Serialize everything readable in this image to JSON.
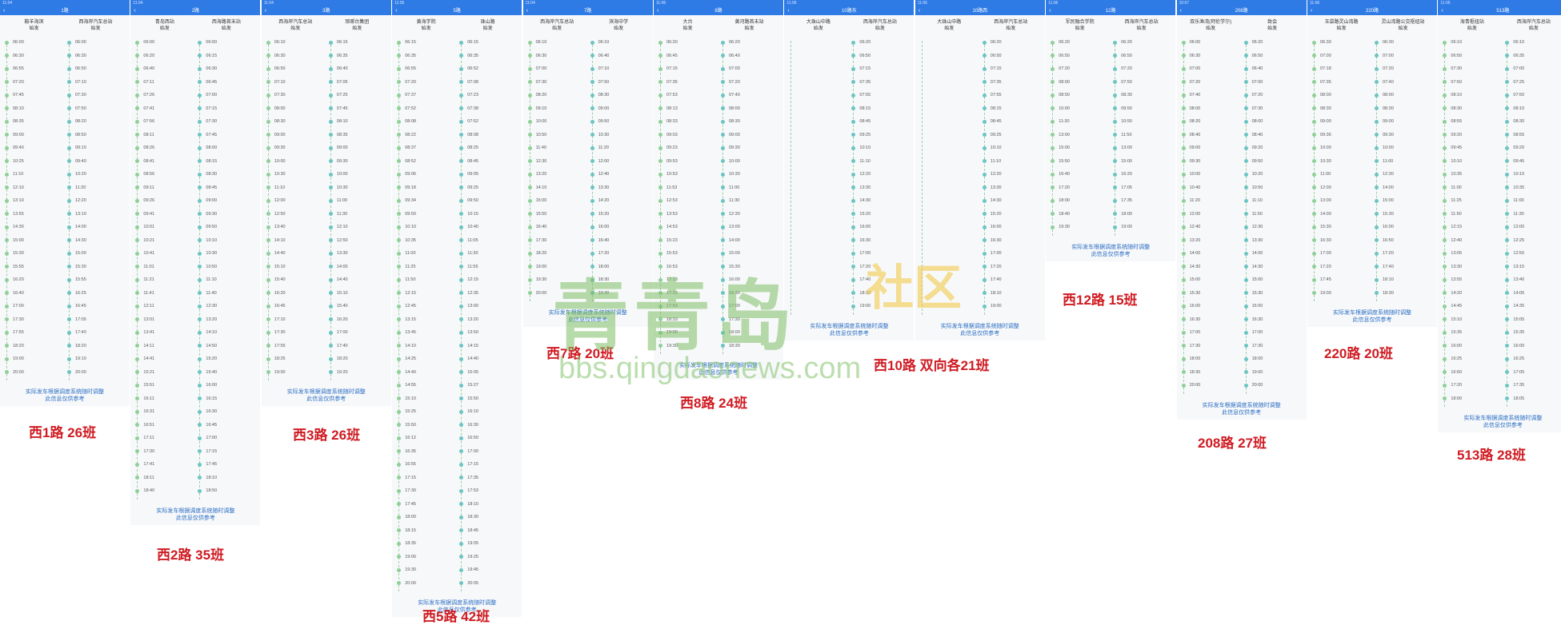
{
  "note_line1": "实际发车根据调度系统随时调整",
  "note_line2": "此信息仅供参考",
  "watermark": {
    "brand": "青青岛",
    "sub": "社区",
    "url": "bbs.qingdaonews.com"
  },
  "panels": [
    {
      "time": "11:04",
      "route": "1路",
      "head_left": "鞍羊海滨\n始发",
      "head_right": "西海岸汽车总站\n始发",
      "times_left": [
        "06:00",
        "06:30",
        "06:55",
        "07:20",
        "07:45",
        "08:10",
        "08:35",
        "09:00",
        "09:40",
        "10:25",
        "11:10",
        "12:10",
        "13:10",
        "13:55",
        "14:30",
        "15:00",
        "15:30",
        "15:55",
        "16:20",
        "16:40",
        "17:00",
        "17:30",
        "17:55",
        "18:20",
        "19:00",
        "20:00"
      ],
      "times_right": [
        "06:00",
        "06:30",
        "06:50",
        "07:10",
        "07:30",
        "07:50",
        "08:20",
        "08:50",
        "09:10",
        "09:40",
        "10:20",
        "11:20",
        "12:20",
        "13:10",
        "14:00",
        "14:30",
        "15:00",
        "15:30",
        "15:55",
        "16:25",
        "16:45",
        "17:05",
        "17:40",
        "18:20",
        "19:10",
        "20:00"
      ],
      "caption": "西1路 26班"
    },
    {
      "time": "11:04",
      "route": "2路",
      "head_left": "青岛西站\n始发",
      "head_right": "西海路首末站\n始发",
      "times_left": [
        "06:00",
        "06:20",
        "06:40",
        "07:11",
        "07:26",
        "07:41",
        "07:56",
        "08:11",
        "08:26",
        "08:41",
        "08:56",
        "09:11",
        "09:26",
        "09:41",
        "10:01",
        "10:21",
        "10:41",
        "11:01",
        "11:21",
        "11:41",
        "12:11",
        "13:01",
        "13:41",
        "14:11",
        "14:41",
        "15:21",
        "15:51",
        "16:11",
        "16:31",
        "16:51",
        "17:11",
        "17:30",
        "17:41",
        "18:11",
        "18:40"
      ],
      "times_right": [
        "06:00",
        "06:15",
        "06:30",
        "06:45",
        "07:00",
        "07:15",
        "07:30",
        "07:45",
        "08:00",
        "08:15",
        "08:30",
        "08:45",
        "09:00",
        "09:30",
        "09:50",
        "10:10",
        "10:30",
        "10:50",
        "11:10",
        "11:40",
        "12:30",
        "13:20",
        "14:10",
        "14:50",
        "15:20",
        "15:40",
        "16:00",
        "16:15",
        "16:30",
        "16:45",
        "17:00",
        "17:15",
        "17:45",
        "18:10",
        "18:50"
      ],
      "caption": "西2路 35班"
    },
    {
      "time": "11:04",
      "route": "3路",
      "head_left": "西海岸汽车总站\n始发",
      "head_right": "琅琊台集团\n始发",
      "times_left": [
        "06:10",
        "06:30",
        "06:50",
        "07:10",
        "07:30",
        "08:00",
        "08:30",
        "09:00",
        "09:30",
        "10:00",
        "10:30",
        "11:10",
        "12:00",
        "12:50",
        "13:40",
        "14:10",
        "14:40",
        "15:10",
        "15:40",
        "16:20",
        "16:45",
        "17:10",
        "17:30",
        "17:55",
        "18:25",
        "19:00"
      ],
      "times_right": [
        "06:15",
        "06:35",
        "06:40",
        "07:05",
        "07:25",
        "07:45",
        "08:10",
        "08:35",
        "09:00",
        "09:30",
        "10:00",
        "10:30",
        "11:00",
        "11:30",
        "12:10",
        "12:50",
        "13:30",
        "14:00",
        "14:40",
        "15:10",
        "15:40",
        "16:20",
        "17:00",
        "17:40",
        "18:20",
        "19:20"
      ],
      "caption": "西3路 26班"
    },
    {
      "time": "11:05",
      "route": "5路",
      "head_left": "黄海学院\n始发",
      "head_right": "珠山路\n始发",
      "times_left": [
        "06:15",
        "06:35",
        "06:55",
        "07:20",
        "07:37",
        "07:52",
        "08:08",
        "08:22",
        "08:37",
        "08:52",
        "09:06",
        "09:18",
        "09:34",
        "09:50",
        "10:10",
        "10:35",
        "11:00",
        "11:25",
        "11:50",
        "12:15",
        "12:45",
        "13:15",
        "13:45",
        "14:10",
        "14:25",
        "14:40",
        "14:55",
        "15:10",
        "15:25",
        "15:50",
        "16:12",
        "16:35",
        "16:55",
        "17:15",
        "17:30",
        "17:45",
        "18:00",
        "18:15",
        "18:35",
        "19:00",
        "19:30",
        "20:00"
      ],
      "times_right": [
        "06:15",
        "06:35",
        "06:52",
        "07:08",
        "07:23",
        "07:38",
        "07:52",
        "08:08",
        "08:25",
        "08:45",
        "09:05",
        "09:25",
        "09:50",
        "10:15",
        "10:40",
        "11:05",
        "11:30",
        "11:55",
        "12:15",
        "12:35",
        "13:00",
        "13:20",
        "13:50",
        "14:15",
        "14:40",
        "15:05",
        "15:27",
        "15:50",
        "16:10",
        "16:30",
        "16:50",
        "17:00",
        "17:15",
        "17:35",
        "17:53",
        "18:10",
        "18:30",
        "18:45",
        "19:05",
        "19:25",
        "19:45",
        "20:05"
      ],
      "caption": "西5路 42班"
    },
    {
      "time": "11:04",
      "route": "7路",
      "head_left": "西海岸汽车总站\n始发",
      "head_right": "滨海中学\n始发",
      "times_left": [
        "06:10",
        "06:30",
        "07:00",
        "07:30",
        "08:20",
        "09:10",
        "10:00",
        "10:50",
        "11:40",
        "12:30",
        "13:20",
        "14:10",
        "15:00",
        "15:50",
        "16:40",
        "17:30",
        "18:20",
        "19:00",
        "19:30",
        "20:00"
      ],
      "times_right": [
        "06:10",
        "06:40",
        "07:10",
        "07:50",
        "08:30",
        "09:00",
        "09:50",
        "10:30",
        "11:20",
        "12:00",
        "12:40",
        "13:30",
        "14:20",
        "15:20",
        "16:00",
        "16:40",
        "17:20",
        "18:00",
        "18:30",
        "19:30"
      ],
      "caption": "西7路 20班"
    },
    {
      "time": "11:06",
      "route": "8路",
      "head_left": "大台\n始发",
      "head_right": "黄河路首末站\n始发",
      "times_left": [
        "06:20",
        "06:45",
        "07:15",
        "07:35",
        "07:53",
        "08:13",
        "08:33",
        "09:03",
        "09:23",
        "09:53",
        "10:53",
        "11:53",
        "12:53",
        "13:53",
        "14:53",
        "15:23",
        "15:53",
        "16:53",
        "17:13",
        "17:33",
        "17:53",
        "18:33",
        "19:00",
        "19:30"
      ],
      "times_right": [
        "06:20",
        "06:40",
        "07:00",
        "07:20",
        "07:40",
        "08:00",
        "08:30",
        "09:00",
        "09:30",
        "10:00",
        "10:30",
        "11:00",
        "11:30",
        "12:30",
        "13:00",
        "14:00",
        "15:00",
        "15:30",
        "16:00",
        "16:30",
        "17:00",
        "17:30",
        "18:00",
        "18:30"
      ],
      "caption": "西8路 24班"
    },
    {
      "time": "11:06",
      "route": "10路东",
      "head_left": "大珠山中路\n始发",
      "head_right": "西海岸汽车总站\n始发",
      "times_left": [],
      "times_right": [
        "06:20",
        "06:50",
        "07:15",
        "07:35",
        "07:55",
        "08:15",
        "08:45",
        "09:25",
        "10:10",
        "11:10",
        "12:20",
        "13:30",
        "14:30",
        "15:20",
        "16:00",
        "16:30",
        "17:00",
        "17:20",
        "17:40",
        "18:10",
        "19:00"
      ],
      "caption": ""
    },
    {
      "time": "11:06",
      "route": "10路西",
      "head_left": "大珠山中路\n始发",
      "head_right": "西海岸汽车总站\n始发",
      "times_left": [],
      "times_right": [
        "06:20",
        "06:50",
        "07:15",
        "07:35",
        "07:55",
        "08:15",
        "08:45",
        "09:25",
        "10:10",
        "11:10",
        "12:20",
        "13:30",
        "14:30",
        "15:20",
        "16:00",
        "16:30",
        "17:00",
        "17:20",
        "17:40",
        "18:10",
        "19:00"
      ],
      "caption": "西10路 双向各21班"
    },
    {
      "time": "11:06",
      "route": "12路",
      "head_left": "军民融合学院\n始发",
      "head_right": "西海岸汽车总站\n始发",
      "times_left": [
        "06:20",
        "06:50",
        "07:20",
        "08:00",
        "08:50",
        "10:00",
        "11:30",
        "13:00",
        "15:00",
        "15:50",
        "16:40",
        "17:20",
        "18:00",
        "18:40",
        "19:30"
      ],
      "times_right": [
        "06:20",
        "06:50",
        "07:20",
        "07:50",
        "08:30",
        "09:50",
        "10:50",
        "11:50",
        "13:00",
        "15:00",
        "16:20",
        "17:05",
        "17:35",
        "18:00",
        "19:00"
      ],
      "caption": "西12路 15班"
    },
    {
      "time": "10:07",
      "route": "208路",
      "head_left": "双乐渔湾(珂伦学尔)\n始发",
      "head_right": "致会\n始发",
      "times_left": [
        "06:00",
        "06:30",
        "07:00",
        "07:20",
        "07:40",
        "08:00",
        "08:20",
        "08:40",
        "09:00",
        "09:30",
        "10:00",
        "10:40",
        "11:20",
        "12:00",
        "12:40",
        "13:20",
        "14:00",
        "14:30",
        "15:00",
        "15:30",
        "16:00",
        "16:30",
        "17:00",
        "17:30",
        "18:00",
        "18:30",
        "20:00"
      ],
      "times_right": [
        "06:20",
        "06:50",
        "06:40",
        "07:00",
        "07:20",
        "07:30",
        "08:00",
        "08:40",
        "09:20",
        "09:50",
        "10:20",
        "10:50",
        "11:10",
        "11:50",
        "12:30",
        "13:30",
        "14:00",
        "14:30",
        "15:00",
        "15:30",
        "16:00",
        "16:30",
        "17:00",
        "17:30",
        "18:00",
        "19:00",
        "20:00"
      ],
      "caption": "208路 27班"
    },
    {
      "time": "11:06",
      "route": "220路",
      "head_left": "玉袋路灵山湾路\n始发",
      "head_right": "灵山湾路公交枢纽站\n始发",
      "times_left": [
        "06:30",
        "07:00",
        "07:18",
        "07:35",
        "08:00",
        "08:30",
        "09:00",
        "09:36",
        "10:00",
        "10:30",
        "11:00",
        "12:00",
        "13:00",
        "14:00",
        "15:30",
        "16:30",
        "17:00",
        "17:20",
        "17:45",
        "19:00"
      ],
      "times_right": [
        "06:30",
        "07:00",
        "07:20",
        "07:40",
        "08:00",
        "08:30",
        "09:00",
        "09:30",
        "10:00",
        "11:00",
        "12:30",
        "14:00",
        "15:00",
        "15:30",
        "16:00",
        "16:50",
        "17:20",
        "17:40",
        "18:10",
        "18:30"
      ],
      "caption": "220路 20班"
    },
    {
      "time": "11:05",
      "route": "513路",
      "head_left": "海青枢纽站\n始发",
      "head_right": "西海岸汽车总站\n始发",
      "times_left": [
        "06:10",
        "06:50",
        "07:30",
        "07:50",
        "08:10",
        "08:30",
        "08:55",
        "09:20",
        "09:45",
        "10:10",
        "10:35",
        "11:00",
        "11:25",
        "11:50",
        "12:15",
        "12:40",
        "13:05",
        "13:30",
        "13:55",
        "14:20",
        "14:45",
        "15:10",
        "15:35",
        "16:00",
        "16:25",
        "16:50",
        "17:20",
        "18:00"
      ],
      "times_right": [
        "06:10",
        "06:35",
        "07:00",
        "07:25",
        "07:50",
        "08:10",
        "08:30",
        "08:55",
        "09:20",
        "09:45",
        "10:10",
        "10:35",
        "11:00",
        "11:30",
        "12:00",
        "12:25",
        "12:50",
        "13:15",
        "13:40",
        "14:05",
        "14:35",
        "15:05",
        "15:35",
        "16:00",
        "16:25",
        "17:05",
        "17:35",
        "18:05"
      ],
      "caption": "513路 28班"
    }
  ]
}
